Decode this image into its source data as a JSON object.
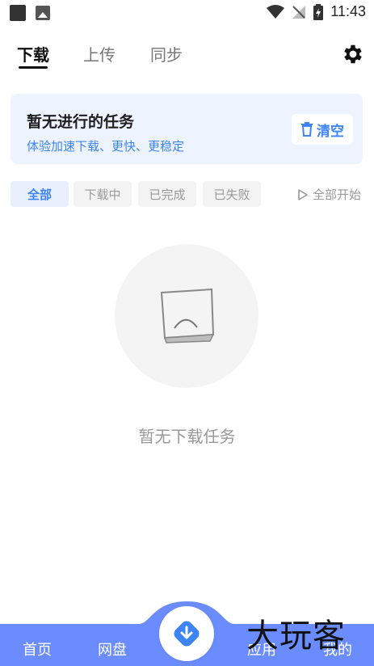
{
  "status_bar": {
    "time": "11:43"
  },
  "top_tabs": [
    {
      "label": "下载",
      "active": true
    },
    {
      "label": "上传",
      "active": false
    },
    {
      "label": "同步",
      "active": false
    }
  ],
  "card": {
    "title": "暂无进行的任务",
    "subtitle": "体验加速下载、更快、更稳定",
    "clear_label": "清空"
  },
  "filters": [
    {
      "label": "全部",
      "active": true
    },
    {
      "label": "下载中",
      "active": false
    },
    {
      "label": "已完成",
      "active": false
    },
    {
      "label": "已失败",
      "active": false
    }
  ],
  "start_all_label": "全部开始",
  "empty_text": "暂无下载任务",
  "bottom_nav": {
    "items": [
      "首页",
      "网盘",
      "应用",
      "我的"
    ]
  },
  "watermark": "大玩客",
  "colors": {
    "accent": "#3d84f5",
    "nav_bar": "#6b8cff",
    "card_bg": "#eef4ff"
  }
}
